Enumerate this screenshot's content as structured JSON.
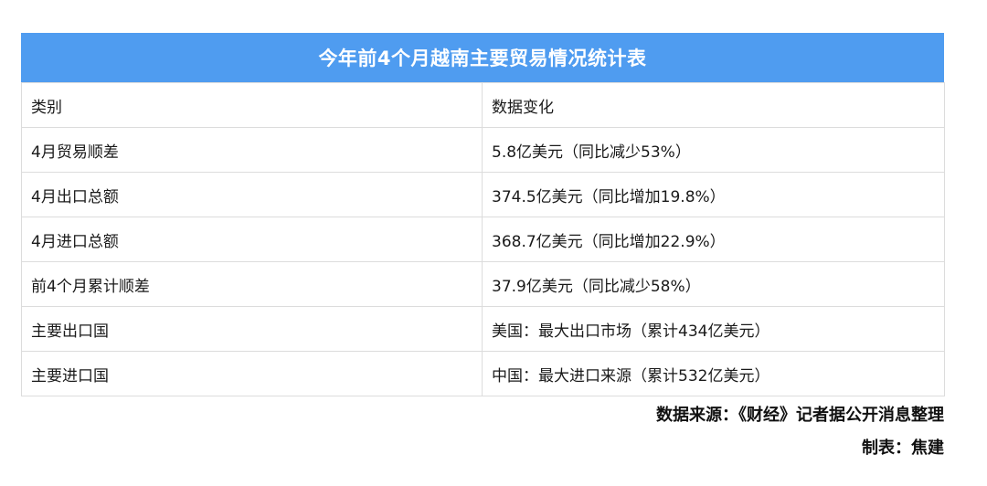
{
  "title": "今年前4个月越南主要贸易情况统计表",
  "header": {
    "col1": "类别",
    "col2": "数据变化"
  },
  "rows": [
    {
      "category": "4月贸易顺差",
      "value": "5.8亿美元（同比减少53%）"
    },
    {
      "category": "4月出口总额",
      "value": "374.5亿美元（同比增加19.8%）"
    },
    {
      "category": "4月进口总额",
      "value": "368.7亿美元（同比增加22.9%）"
    },
    {
      "category": "前4个月累计顺差",
      "value": "37.9亿美元（同比减少58%）"
    },
    {
      "category": "主要出口国",
      "value": "美国：最大出口市场（累计434亿美元）"
    },
    {
      "category": "主要进口国",
      "value": "中国：最大进口来源（累计532亿美元）"
    }
  ],
  "footer": {
    "source": "数据来源：《财经》记者据公开消息整理",
    "made_by": "制表：焦建"
  },
  "colors": {
    "title_bg": "#4f9cf0",
    "title_text": "#ffffff",
    "border": "#dcdcdc"
  }
}
